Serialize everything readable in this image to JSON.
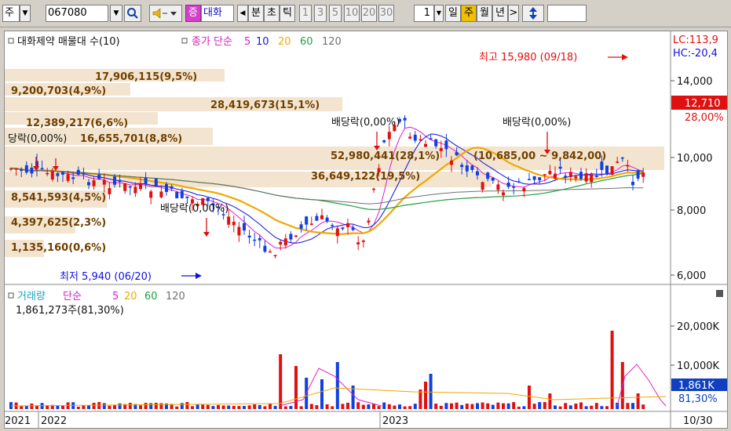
{
  "toolbar": {
    "market": "주",
    "code": "067080",
    "badge": "증",
    "name": "대화",
    "mode": "분",
    "chart_btn": "초",
    "tick_btn": "틱",
    "intervals": [
      "1",
      "3",
      "5",
      "10",
      "20",
      "30"
    ],
    "count": "1",
    "day": "일",
    "week": "주",
    "month": "월",
    "year": "년",
    "next": ">"
  },
  "price_panel": {
    "legend_title": "대화제약 매물대 수(10)",
    "legend_ma_label": "종가 단순",
    "ma_periods": [
      "5",
      "10",
      "20",
      "60",
      "120"
    ],
    "ma_colors": [
      "#e020c8",
      "#1010e0",
      "#f0a800",
      "#20a040",
      "#707070"
    ],
    "lc": "LC:113,9",
    "hc": "HC:-20,4",
    "high_note": "최고 15,980 (09/18)",
    "low_note": "최저 5,940 (06/20)",
    "current_price": "12,710",
    "current_pct": "28,00%",
    "y_ticks": [
      "14,000",
      "10,000",
      "8,000",
      "6,000"
    ],
    "volume_profile": [
      "17,906,115(9,5%)",
      "9,200,703(4,9%)",
      "28,419,673(15,1%)",
      "12,389,217(6,6%)",
      "16,655,701(8,8%)",
      "52,980,441(28,1%)",
      "36,649,122(19,5%)",
      "8,541,593(4,5%)",
      "4,397,625(2,3%)",
      "1,135,160(0,6%)"
    ],
    "range_label": "(10,685,00 ~ 9,842,00)",
    "dividend_labels": [
      "당락(0,00%)",
      "배당락(0,00%)",
      "배당락(0,00%)",
      "배당락(0,00%)"
    ]
  },
  "volume_panel": {
    "legend_title": "거래량",
    "legend_ma_label": "단순",
    "ma_periods": [
      "5",
      "20",
      "60",
      "120"
    ],
    "last_volume": "1,861,273주(81,30%)",
    "y_ticks": [
      "20,000K",
      "10,000K"
    ],
    "current_volume": "1,861K",
    "current_pct": "81,30%"
  },
  "x_axis": {
    "labels": [
      "2021",
      "2022",
      "2023"
    ],
    "date": "10/30"
  }
}
